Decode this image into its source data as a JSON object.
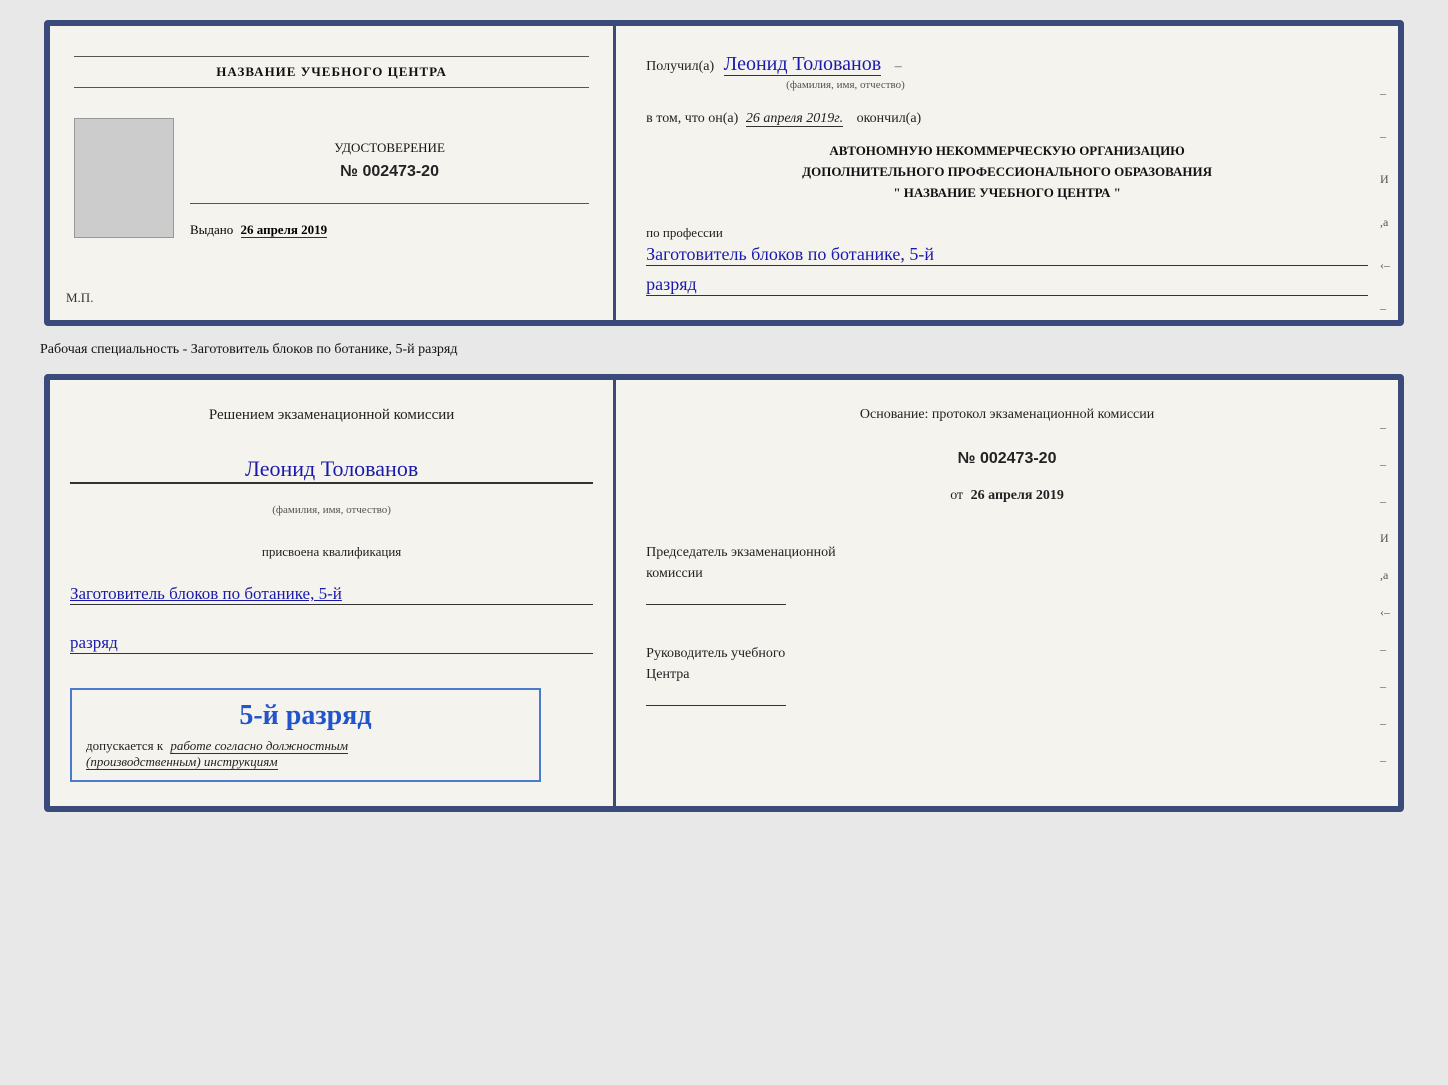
{
  "card1": {
    "left": {
      "org_name": "НАЗВАНИЕ УЧЕБНОГО ЦЕНТРА",
      "cert_label": "УДОСТОВЕРЕНИЕ",
      "cert_number": "№ 002473-20",
      "issued_label": "Выдано",
      "issued_date": "26 апреля 2019",
      "mp_label": "М.П."
    },
    "right": {
      "received_prefix": "Получил(а)",
      "person_name": "Леонид Толованов",
      "name_subtitle": "(фамилия, имя, отчество)",
      "date_prefix": "в том, что он(а)",
      "date_value": "26 апреля 2019г.",
      "date_suffix": "окончил(а)",
      "org_line1": "АВТОНОМНУЮ НЕКОММЕРЧЕСКУЮ ОРГАНИЗАЦИЮ",
      "org_line2": "ДОПОЛНИТЕЛЬНОГО ПРОФЕССИОНАЛЬНОГО ОБРАЗОВАНИЯ",
      "org_line3": "\" НАЗВАНИЕ УЧЕБНОГО ЦЕНТРА \"",
      "profession_prefix": "по профессии",
      "profession_name": "Заготовитель блоков по ботанике, 5-й",
      "razryad": "разряд",
      "dash_labels": [
        "–",
        "–",
        "И",
        ",а",
        "‹–",
        "–",
        "–",
        "–",
        "–"
      ]
    }
  },
  "separator": {
    "text": "Рабочая специальность - Заготовитель блоков по ботанике, 5-й разряд"
  },
  "card2": {
    "left": {
      "decision_text": "Решением экзаменационной комиссии",
      "person_name": "Леонид Толованов",
      "name_subtitle": "(фамилия, имя, отчество)",
      "assigned_label": "присвоена квалификация",
      "qualification": "Заготовитель блоков по ботанике, 5-й",
      "razryad": "разряд",
      "stamp_main": "5-й разряд",
      "stamp_prefix": "допускается к",
      "stamp_italic": "работе согласно должностным",
      "stamp_italic2": "(производственным) инструкциям"
    },
    "right": {
      "basis_text": "Основание: протокол экзаменационной комиссии",
      "proto_number": "№ 002473-20",
      "date_prefix": "от",
      "date_value": "26 апреля 2019",
      "chair_label": "Председатель экзаменационной",
      "chair_label2": "комиссии",
      "head_label": "Руководитель учебного",
      "head_label2": "Центра",
      "dash_labels": [
        "–",
        "–",
        "–",
        "И",
        ",а",
        "‹–",
        "–",
        "–",
        "–",
        "–"
      ]
    }
  }
}
